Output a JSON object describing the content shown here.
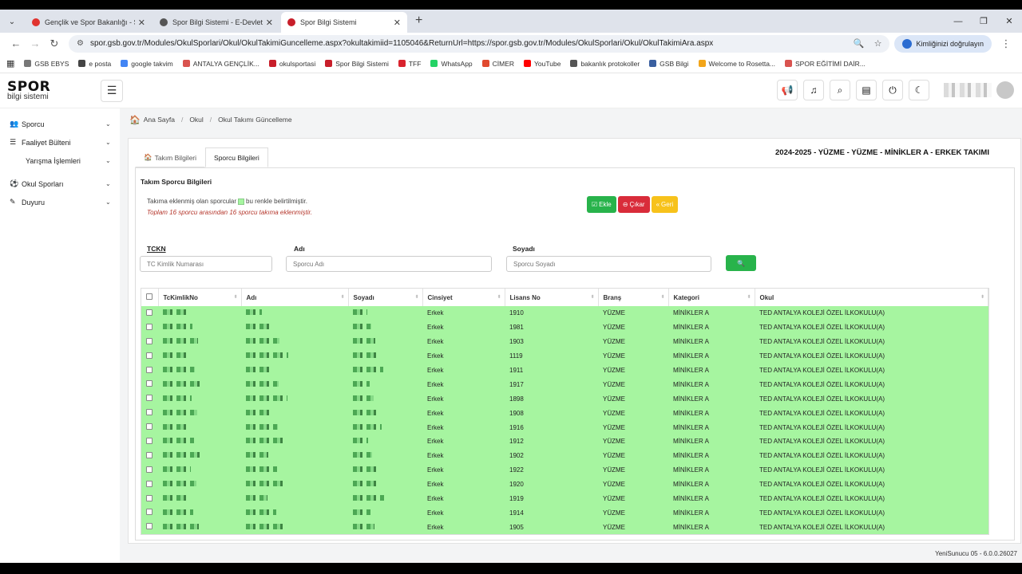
{
  "browser": {
    "tabs": [
      {
        "label": "Gençlik ve Spor Bakanlığı - Spor",
        "color": "#e0332f",
        "active": false
      },
      {
        "label": "Spor Bilgi Sistemi - E-Devlet Po",
        "color": "#555555",
        "active": false
      },
      {
        "label": "Spor Bilgi Sistemi",
        "color": "#c81e2a",
        "active": true
      }
    ],
    "url": "spor.gsb.gov.tr/Modules/OkulSporlari/Okul/OkulTakimiGuncelleme.aspx?okultakimiid=1105046&ReturnUrl=https://spor.gsb.gov.tr/Modules/OkulSporlari/Okul/OkulTakimiAra.aspx",
    "verify_label": "Kimliğinizi doğrulayın",
    "bookmarks": [
      {
        "label": "GSB EBYS",
        "color": "#777777"
      },
      {
        "label": "e posta",
        "color": "#444444"
      },
      {
        "label": "google takvim",
        "color": "#4285f4"
      },
      {
        "label": "ANTALYA GENÇLİK...",
        "color": "#d9534f"
      },
      {
        "label": "okulsportasi",
        "color": "#c81e2a"
      },
      {
        "label": "Spor Bilgi Sistemi",
        "color": "#c81e2a"
      },
      {
        "label": "TFF",
        "color": "#d9232e"
      },
      {
        "label": "WhatsApp",
        "color": "#25d366"
      },
      {
        "label": "CİMER",
        "color": "#e04a2f"
      },
      {
        "label": "YouTube",
        "color": "#ff0000"
      },
      {
        "label": "bakanlık protokoller",
        "color": "#555555"
      },
      {
        "label": "GSB Bilgi",
        "color": "#3a5fa0"
      },
      {
        "label": "Welcome to Rosetta...",
        "color": "#f2a51a"
      },
      {
        "label": "SPOR EĞİTİMİ DAİR...",
        "color": "#d9534f"
      }
    ]
  },
  "app": {
    "logo_top": "SPOR",
    "logo_bottom": "bilgi sistemi"
  },
  "sidebar": {
    "items": [
      {
        "label": "Sporcu",
        "icon": "users-icon"
      },
      {
        "label": "Faaliyet Bülteni",
        "icon": "list-icon"
      },
      {
        "label": "Yarışma İşlemleri",
        "icon": ""
      },
      {
        "label": "Okul Sporları",
        "icon": "ball-icon"
      },
      {
        "label": "Duyuru",
        "icon": "edit-icon"
      }
    ]
  },
  "breadcrumb": [
    "Ana Sayfa",
    "Okul",
    "Okul Takımı Güncelleme"
  ],
  "tabs": [
    "Takım Bilgileri",
    "Sporcu Bilgileri"
  ],
  "team_title": "2024-2025 - YÜZME - YÜZME - MİNİKLER A - ERKEK TAKIMI",
  "section_title": "Takım Sporcu Bilgileri",
  "info_before": "Takıma eklenmiş olan sporcular",
  "info_after": "bu renkle belirtilmiştir.",
  "info_count": "Toplam 16 sporcu arasından 16 sporcu takıma eklenmiştir.",
  "highlight_color": "#a6f5a0",
  "buttons": {
    "add": "Ekle",
    "remove": "Çıkar",
    "back": "Geri"
  },
  "filters": {
    "tckn_label": "TCKN",
    "tckn_placeholder": "TC Kimlik Numarası",
    "name_label": "Adı",
    "name_placeholder": "Sporcu Adı",
    "surname_label": "Soyadı",
    "surname_placeholder": "Sporcu Soyadı"
  },
  "table": {
    "columns": [
      "TcKimlikNo",
      "Adı",
      "Soyadı",
      "Cinsiyet",
      "Lisans No",
      "Branş",
      "Kategori",
      "Okul"
    ],
    "rows": [
      {
        "gender": "Erkek",
        "license": "1910",
        "branch": "YÜZME",
        "category": "MİNİKLER A",
        "school": "TED ANTALYA KOLEJİ ÖZEL İLKOKULU(A)"
      },
      {
        "gender": "Erkek",
        "license": "1981",
        "branch": "YÜZME",
        "category": "MİNİKLER A",
        "school": "TED ANTALYA KOLEJİ ÖZEL İLKOKULU(A)"
      },
      {
        "gender": "Erkek",
        "license": "1903",
        "branch": "YÜZME",
        "category": "MİNİKLER A",
        "school": "TED ANTALYA KOLEJİ ÖZEL İLKOKULU(A)"
      },
      {
        "gender": "Erkek",
        "license": "1119",
        "branch": "YÜZME",
        "category": "MİNİKLER A",
        "school": "TED ANTALYA KOLEJİ ÖZEL İLKOKULU(A)"
      },
      {
        "gender": "Erkek",
        "license": "1911",
        "branch": "YÜZME",
        "category": "MİNİKLER A",
        "school": "TED ANTALYA KOLEJİ ÖZEL İLKOKULU(A)"
      },
      {
        "gender": "Erkek",
        "license": "1917",
        "branch": "YÜZME",
        "category": "MİNİKLER A",
        "school": "TED ANTALYA KOLEJİ ÖZEL İLKOKULU(A)"
      },
      {
        "gender": "Erkek",
        "license": "1898",
        "branch": "YÜZME",
        "category": "MİNİKLER A",
        "school": "TED ANTALYA KOLEJİ ÖZEL İLKOKULU(A)"
      },
      {
        "gender": "Erkek",
        "license": "1908",
        "branch": "YÜZME",
        "category": "MİNİKLER A",
        "school": "TED ANTALYA KOLEJİ ÖZEL İLKOKULU(A)"
      },
      {
        "gender": "Erkek",
        "license": "1916",
        "branch": "YÜZME",
        "category": "MİNİKLER A",
        "school": "TED ANTALYA KOLEJİ ÖZEL İLKOKULU(A)"
      },
      {
        "gender": "Erkek",
        "license": "1912",
        "branch": "YÜZME",
        "category": "MİNİKLER A",
        "school": "TED ANTALYA KOLEJİ ÖZEL İLKOKULU(A)"
      },
      {
        "gender": "Erkek",
        "license": "1902",
        "branch": "YÜZME",
        "category": "MİNİKLER A",
        "school": "TED ANTALYA KOLEJİ ÖZEL İLKOKULU(A)"
      },
      {
        "gender": "Erkek",
        "license": "1922",
        "branch": "YÜZME",
        "category": "MİNİKLER A",
        "school": "TED ANTALYA KOLEJİ ÖZEL İLKOKULU(A)"
      },
      {
        "gender": "Erkek",
        "license": "1920",
        "branch": "YÜZME",
        "category": "MİNİKLER A",
        "school": "TED ANTALYA KOLEJİ ÖZEL İLKOKULU(A)"
      },
      {
        "gender": "Erkek",
        "license": "1919",
        "branch": "YÜZME",
        "category": "MİNİKLER A",
        "school": "TED ANTALYA KOLEJİ ÖZEL İLKOKULU(A)"
      },
      {
        "gender": "Erkek",
        "license": "1914",
        "branch": "YÜZME",
        "category": "MİNİKLER A",
        "school": "TED ANTALYA KOLEJİ ÖZEL İLKOKULU(A)"
      },
      {
        "gender": "Erkek",
        "license": "1905",
        "branch": "YÜZME",
        "category": "MİNİKLER A",
        "school": "TED ANTALYA KOLEJİ ÖZEL İLKOKULU(A)"
      }
    ]
  },
  "footer": "YeniSunucu 05 - 6.0.0.26027"
}
